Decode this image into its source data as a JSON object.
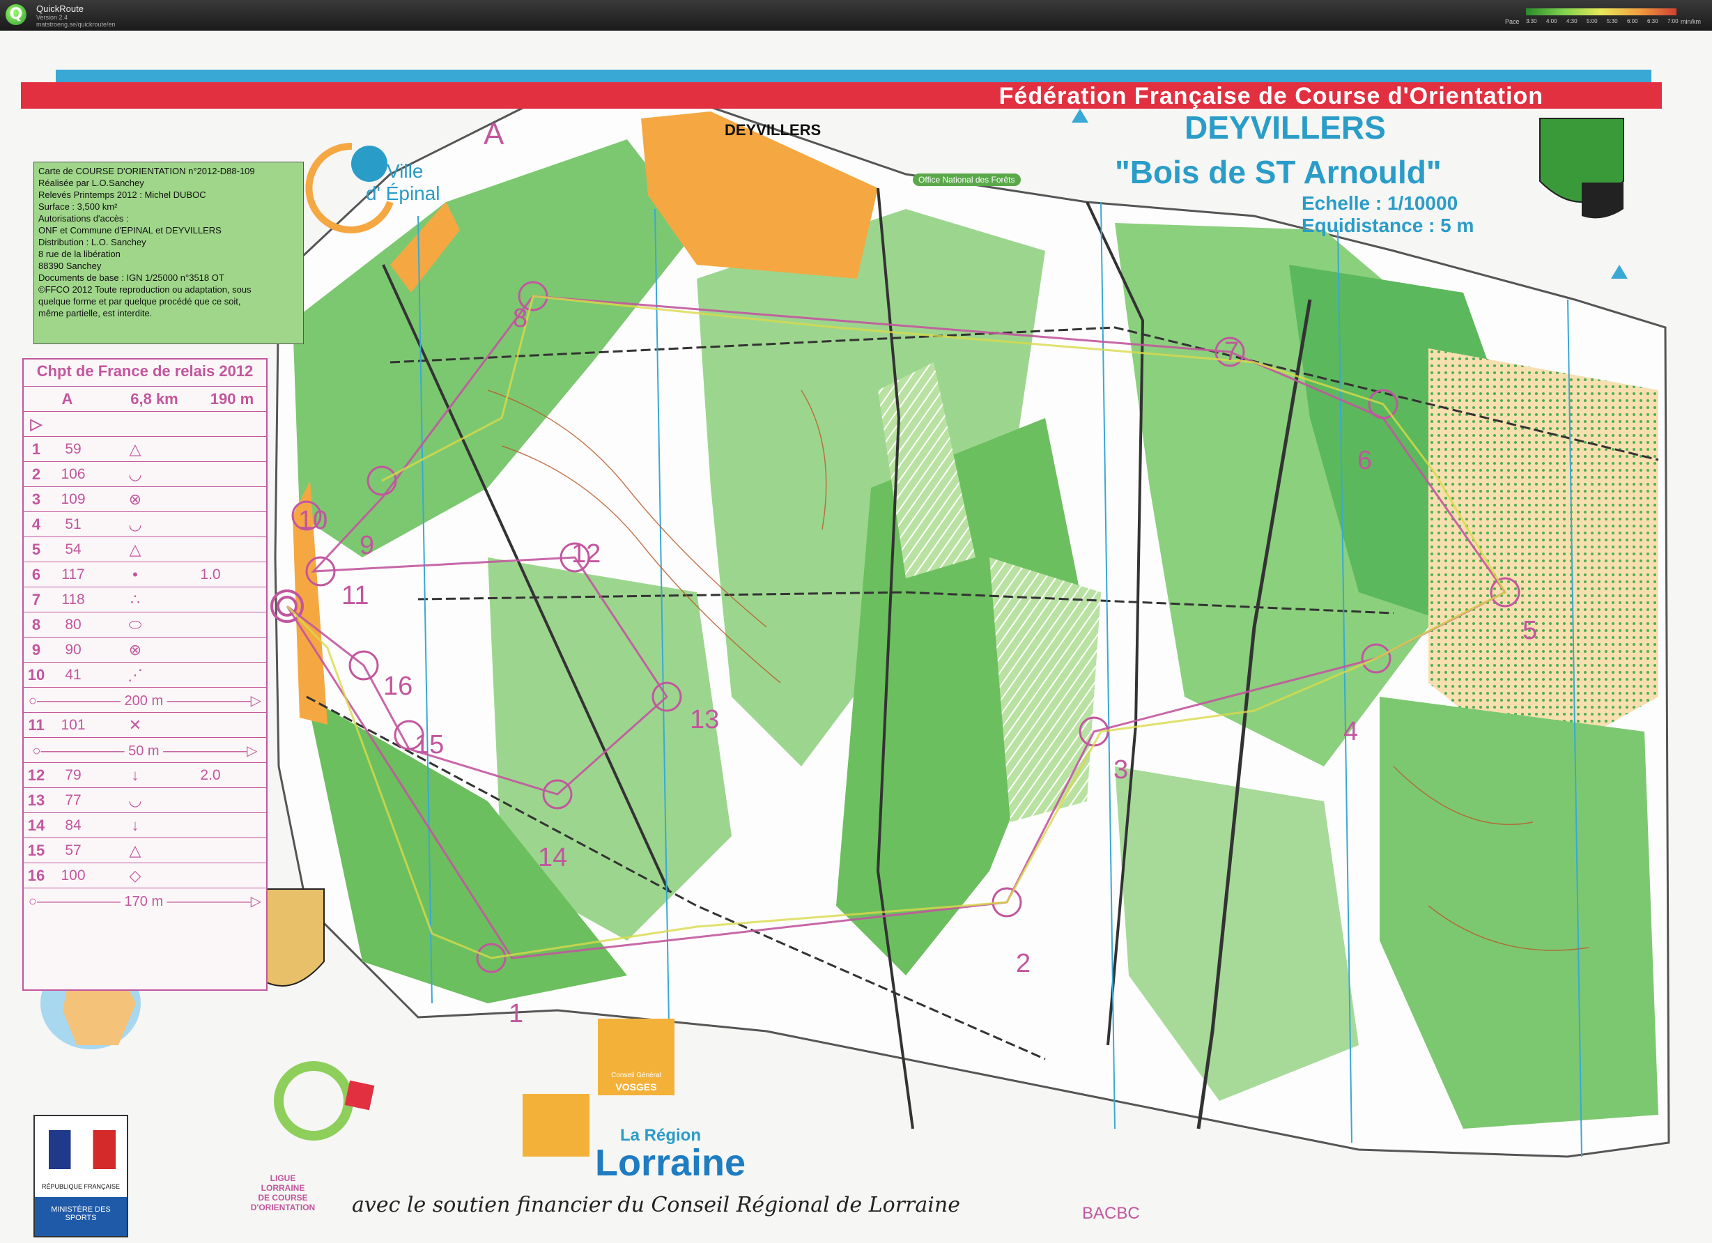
{
  "app": {
    "title": "QuickRoute",
    "version": "Version 2.4",
    "url": "matstroeng.se/quickroute/en",
    "pace_label": "Pace",
    "pace_unit": "min/km",
    "pace_ticks": [
      "3:30",
      "4:00",
      "4:30",
      "5:00",
      "5:30",
      "6:00",
      "6:30",
      "7:00"
    ]
  },
  "map": {
    "federation": "Fédération Française de Course d'Orientation",
    "title": "DEYVILLERS",
    "subtitle": "\"Bois de ST Arnould\"",
    "scale": "Echelle : 1/10000",
    "equidistance": "Equidistance : 5 m",
    "town": "DEYVILLERS",
    "course_letter": "A",
    "ville": "Ville",
    "epinal": "d' Épinal",
    "onf": "Office National des Forêts",
    "bottom_code": "BACBC",
    "info": [
      "Carte de COURSE D'ORIENTATION  n°2012-D88-109",
      "Réalisée par L.O.Sanchey",
      "Relevés Printemps 2012  : Michel DUBOC",
      "Surface :   3,500 km²",
      "Autorisations d'accès :",
      "ONF  et Commune d'EPINAL et DEYVILLERS",
      "Distribution : L.O. Sanchey",
      "8 rue de la libération",
      "88390 Sanchey",
      "Documents de base : IGN 1/25000 n°3518 OT",
      "©FFCO 2012  Toute reproduction ou adaptation, sous",
      "quelque forme et par quelque procédé que ce soit,",
      "même partielle, est interdite."
    ],
    "sponsors": {
      "region_small": "La Région",
      "region_big": "Lorraine",
      "support": "avec le soutien financier du Conseil Régional de Lorraine",
      "cg_small": "Conseil Général",
      "cg_big": "VOSGES",
      "ligue": [
        "LIGUE",
        "LORRAINE",
        "DE COURSE",
        "D'ORIENTATION"
      ],
      "rf": "RÉPUBLIQUE FRANÇAISE",
      "ministere": "MINISTÈRE DES SPORTS"
    }
  },
  "descriptions": {
    "event": "Chpt de France de relais 2012",
    "course": "A",
    "length": "6,8 km",
    "climb": "190 m",
    "controls": [
      {
        "n": "1",
        "code": "59",
        "sym": "△",
        "extra": ""
      },
      {
        "n": "2",
        "code": "106",
        "sym": "◡",
        "extra": ""
      },
      {
        "n": "3",
        "code": "109",
        "sym": "⊗",
        "extra": ""
      },
      {
        "n": "4",
        "code": "51",
        "sym": "◡",
        "extra": ""
      },
      {
        "n": "5",
        "code": "54",
        "sym": "△",
        "extra": ""
      },
      {
        "n": "6",
        "code": "117",
        "sym": "•",
        "extra": "1.0"
      },
      {
        "n": "7",
        "code": "118",
        "sym": "∴",
        "extra": ""
      },
      {
        "n": "8",
        "code": "80",
        "sym": "⬭",
        "extra": ""
      },
      {
        "n": "9",
        "code": "90",
        "sym": "⊗",
        "extra": ""
      },
      {
        "n": "10",
        "code": "41",
        "sym": "⋰",
        "extra": ""
      },
      {
        "n": "11",
        "code": "101",
        "sym": "✕",
        "extra": ""
      },
      {
        "n": "12",
        "code": "79",
        "sym": "↓",
        "extra": "2.0"
      },
      {
        "n": "13",
        "code": "77",
        "sym": "◡",
        "extra": ""
      },
      {
        "n": "14",
        "code": "84",
        "sym": "↓",
        "extra": ""
      },
      {
        "n": "15",
        "code": "57",
        "sym": "△",
        "extra": ""
      },
      {
        "n": "16",
        "code": "100",
        "sym": "◇",
        "extra": ""
      }
    ],
    "tape_200": "200 m",
    "tape_50": "50 m",
    "tape_170": "170 m"
  },
  "control_labels": [
    "1",
    "2",
    "3",
    "4",
    "5",
    "6",
    "7",
    "8",
    "9",
    "10",
    "11",
    "12",
    "13",
    "14",
    "15",
    "16"
  ],
  "colors": {
    "course_magenta": "#c2569e",
    "forest_green": "#5cb85c",
    "banner_red": "#e23040",
    "title_blue": "#2a9cc8"
  }
}
